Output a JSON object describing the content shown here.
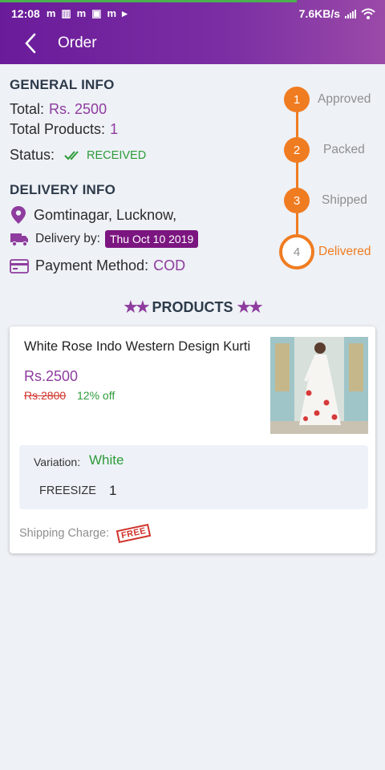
{
  "status_bar": {
    "time": "12:08",
    "network_speed": "7.6KB/s",
    "notification_icons": [
      "m-icon",
      "app-icon",
      "m-icon",
      "photo-icon",
      "m-icon",
      "play-icon"
    ]
  },
  "header": {
    "title": "Order"
  },
  "general_info": {
    "heading": "GENERAL INFO",
    "total_label": "Total:",
    "total_value": "Rs. 2500",
    "products_label": "Total Products:",
    "products_value": "1",
    "status_label": "Status:",
    "status_value": "RECEIVED"
  },
  "delivery_info": {
    "heading": "DELIVERY INFO",
    "address": "Gomtinagar, Lucknow,",
    "delivery_label": "Delivery by:",
    "delivery_date": "Thu Oct 10 2019",
    "payment_label": "Payment Method:",
    "payment_value": "COD"
  },
  "order_steps": [
    {
      "num": "1",
      "label": "Approved",
      "active": false
    },
    {
      "num": "2",
      "label": "Packed",
      "active": false
    },
    {
      "num": "3",
      "label": "Shipped",
      "active": false
    },
    {
      "num": "4",
      "label": "Delivered",
      "active": true
    }
  ],
  "products": {
    "heading": "PRODUCTS",
    "items": [
      {
        "name": "White Rose Indo Western Design Kurti",
        "price": "Rs.2500",
        "old_price": "Rs.2800",
        "discount": "12% off",
        "variation_label": "Variation:",
        "variation_value": "White",
        "size_label": "FREESIZE",
        "size_qty": "1",
        "shipping_label": "Shipping Charge:",
        "shipping_badge": "FREE"
      }
    ]
  },
  "colors": {
    "primary": "#7b1fa2",
    "accent_orange": "#f07c21",
    "success_green": "#2e9b3a",
    "price_purple": "#8e3c9e"
  }
}
